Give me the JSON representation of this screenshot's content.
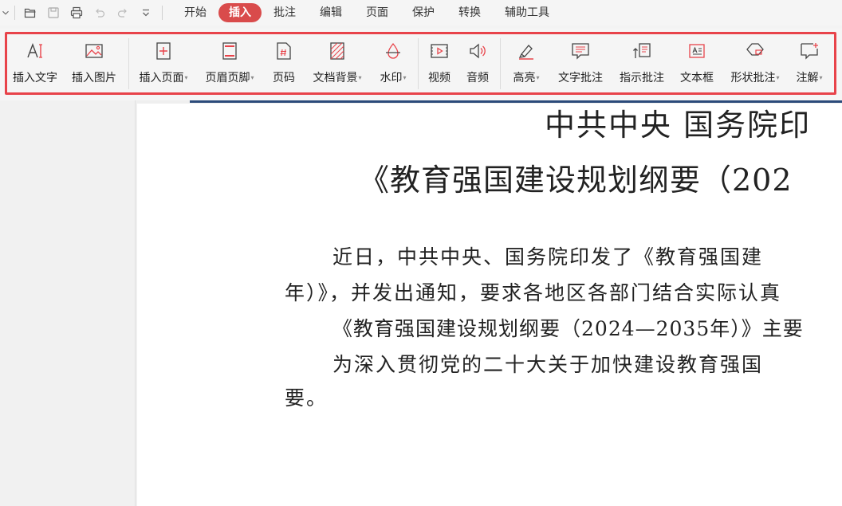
{
  "menubar": {
    "quick_access_icons": [
      "open-folder-icon",
      "save-icon",
      "print-icon",
      "undo-icon",
      "redo-icon",
      "customize-icon"
    ],
    "tabs": [
      {
        "label": "开始"
      },
      {
        "label": "插入",
        "active": true
      },
      {
        "label": "批注"
      },
      {
        "label": "编辑"
      },
      {
        "label": "页面"
      },
      {
        "label": "保护"
      },
      {
        "label": "转换"
      },
      {
        "label": "辅助工具"
      }
    ]
  },
  "ribbon": {
    "accent_color": "#e8434a",
    "tools": [
      {
        "label": "插入文字",
        "icon": "insert-text-icon"
      },
      {
        "label": "插入图片",
        "icon": "insert-image-icon"
      },
      {
        "label": "插入页面",
        "icon": "insert-page-icon",
        "dropdown": true
      },
      {
        "label": "页眉页脚",
        "icon": "header-footer-icon",
        "dropdown": true
      },
      {
        "label": "页码",
        "icon": "page-number-icon"
      },
      {
        "label": "文档背景",
        "icon": "document-background-icon",
        "dropdown": true
      },
      {
        "label": "水印",
        "icon": "watermark-icon",
        "dropdown": true
      },
      {
        "label": "视频",
        "icon": "video-icon"
      },
      {
        "label": "音频",
        "icon": "audio-icon"
      },
      {
        "label": "高亮",
        "icon": "highlight-icon",
        "dropdown": true
      },
      {
        "label": "文字批注",
        "icon": "text-comment-icon"
      },
      {
        "label": "指示批注",
        "icon": "pointer-comment-icon"
      },
      {
        "label": "文本框",
        "icon": "text-box-icon"
      },
      {
        "label": "形状批注",
        "icon": "shape-comment-icon",
        "dropdown": true
      },
      {
        "label": "注解",
        "icon": "annotation-icon",
        "dropdown": true
      }
    ],
    "caret": "▾"
  },
  "document": {
    "title_line1": "中共中央 国务院印",
    "title_line2": "《教育强国建设规划纲要（202",
    "paragraphs": [
      "近日，中共中央、国务院印发了《教育强国建",
      "年）》，并发出通知，要求各地区各部门结合实际认真",
      "《教育强国建设规划纲要（2024—2035年）》主要",
      "为深入贯彻党的二十大关于加快建设教育强国",
      "要。"
    ]
  }
}
